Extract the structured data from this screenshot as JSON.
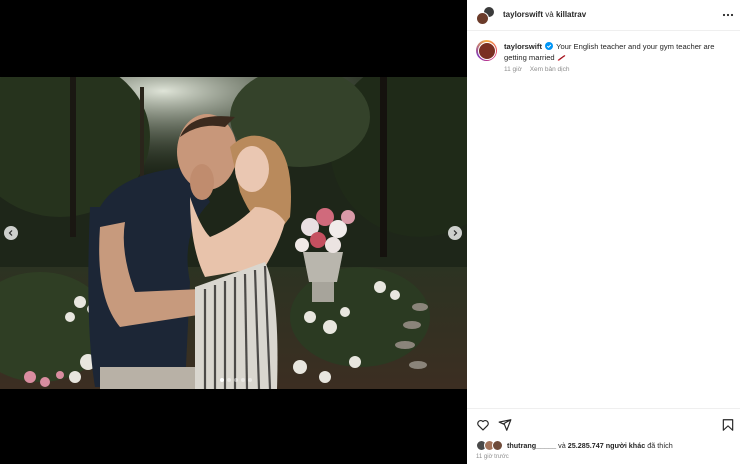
{
  "header": {
    "author": "taylorswift",
    "conjunction": "và",
    "coauthor": "killatrav",
    "more_icon": "more-horizontal-icon"
  },
  "post": {
    "carousel": {
      "slide_count": 5,
      "active_index": 0
    }
  },
  "caption": {
    "username": "taylorswift",
    "verified_icon": "verified-badge-icon",
    "text": "Your English teacher and your gym teacher are getting married",
    "emoji_icon": "lips-emoji-icon",
    "time": "11 giờ",
    "translate_label": "Xem bản dịch"
  },
  "actions": {
    "like_icon": "heart-icon",
    "share_icon": "send-icon",
    "save_icon": "bookmark-icon"
  },
  "likes": {
    "user": "thutrang_____",
    "connector": "và",
    "count": "25.285.747",
    "others_label": "người khác",
    "suffix": "đã thích"
  },
  "timestamp": "11 giờ trước",
  "colors": {
    "verified": "#0095f6",
    "text": "#262626",
    "muted": "#8e8e8e",
    "media_bg": "#000000"
  }
}
